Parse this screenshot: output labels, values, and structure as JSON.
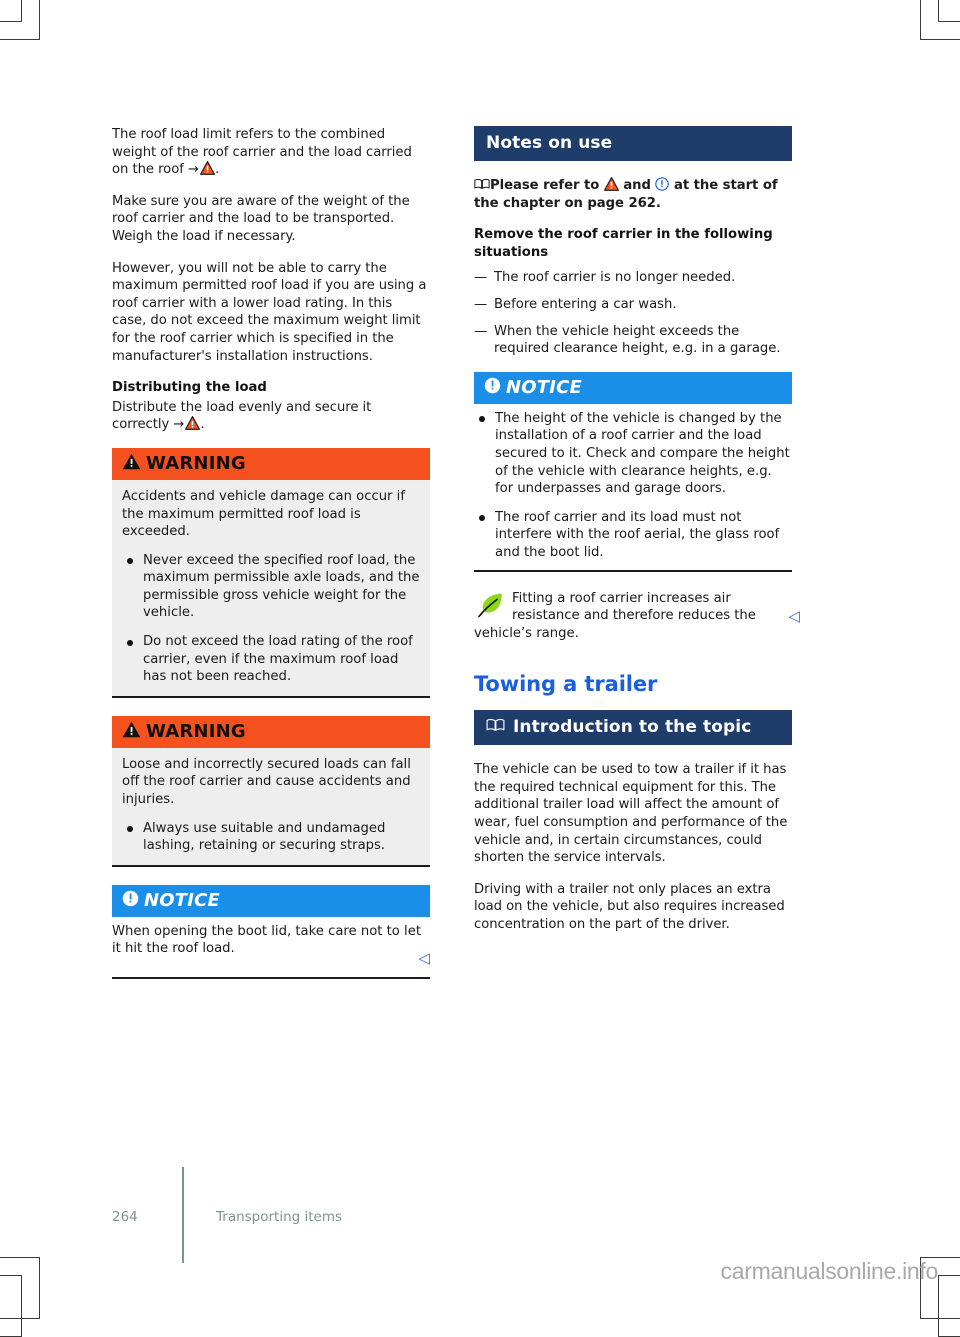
{
  "page": {
    "number": "264",
    "chapter": "Transporting items",
    "watermark": "carmanualsonline.info"
  },
  "left_column": {
    "paragraphs": [
      {
        "id": "roof-load-limit",
        "before": "The roof load limit refers to the combined weight of the roof carrier and the load carried on the roof ",
        "arrow": "→",
        "icon": "warning-triangle-icon",
        "after": "."
      },
      {
        "id": "weigh-load",
        "text": "Make sure you are aware of the weight of the roof carrier and the load to be transported. Weigh the load if necessary."
      },
      {
        "id": "lower-load-rating",
        "text": "However, you will not be able to carry the maximum permitted roof load if you are using a roof carrier with a lower load rating. In this case, do not exceed the maximum weight limit for the roof carrier which is specified in the manufacturer's installation instructions."
      }
    ],
    "distributing": {
      "heading": "Distributing the load",
      "before": "Distribute the load evenly and secure it correctly ",
      "arrow": "→",
      "icon": "warning-triangle-icon",
      "after": "."
    },
    "warning_1": {
      "label": "WARNING",
      "intro": "Accidents and vehicle damage can occur if the maximum permitted roof load is exceeded.",
      "bullets": [
        "Never exceed the specified roof load, the maximum permissible axle loads, and the permissible gross vehicle weight for the vehicle.",
        "Do not exceed the load rating of the roof carrier, even if the maximum roof load has not been reached."
      ]
    },
    "warning_2": {
      "label": "WARNING",
      "intro": "Loose and incorrectly secured loads can fall off the roof carrier and cause accidents and injuries.",
      "bullets": [
        "Always use suitable and undamaged lashing, retaining or securing straps."
      ]
    },
    "notice_1": {
      "label": "NOTICE",
      "text": "When opening the boot lid, take care not to let it hit the roof load.",
      "end_marker": "◁"
    }
  },
  "right_column": {
    "banner_notes": {
      "label": "Notes on use"
    },
    "refer_note": {
      "book_icon": "book-icon",
      "part1": "Please refer to ",
      "warning_icon": "warning-triangle-icon",
      "part2": " and ",
      "notice_icon": "notice-circle-icon",
      "part3": " at the start of the chapter on page 262."
    },
    "remove_carrier": {
      "heading": "Remove the roof carrier in the following situations",
      "items": [
        "The roof carrier is no longer needed.",
        "Before entering a car wash.",
        "When the vehicle height exceeds the required clearance height, e.g. in a garage."
      ]
    },
    "notice_2": {
      "label": "NOTICE",
      "bullets": [
        "The height of the vehicle is changed by the installation of a roof carrier and the load secured to it. Check and compare the height of the vehicle with clearance heights, e.g. for underpasses and garage doors.",
        "The roof carrier and its load must not interfere with the roof aerial, the glass roof and the boot lid."
      ]
    },
    "eco_note": {
      "leaf_icon": "leaf-icon",
      "text": "Fitting a roof carrier increases air resistance and therefore reduces the vehicle’s range.",
      "end_marker": "◁"
    },
    "chapter_title": "Towing a trailer",
    "banner_intro": {
      "book_icon": "book-icon",
      "label": "Introduction to the topic"
    },
    "intro_paragraphs": [
      "The vehicle can be used to tow a trailer if it has the required technical equipment for this. The additional trailer load will affect the amount of wear, fuel consumption and performance of the vehicle and, in certain circumstances, could shorten the service intervals.",
      "Driving with a trailer not only places an extra load on the vehicle, but also requires increased concentration on the part of the driver."
    ]
  },
  "colors": {
    "warning_banner": "#f4511e",
    "notice_banner": "#1b8fe8",
    "dark_banner": "#1f3d6b",
    "chapter_title": "#1a5fdb",
    "leaf": "#8cd61c",
    "footer_text": "#7d9494",
    "end_marker": "#2a6fe0"
  }
}
